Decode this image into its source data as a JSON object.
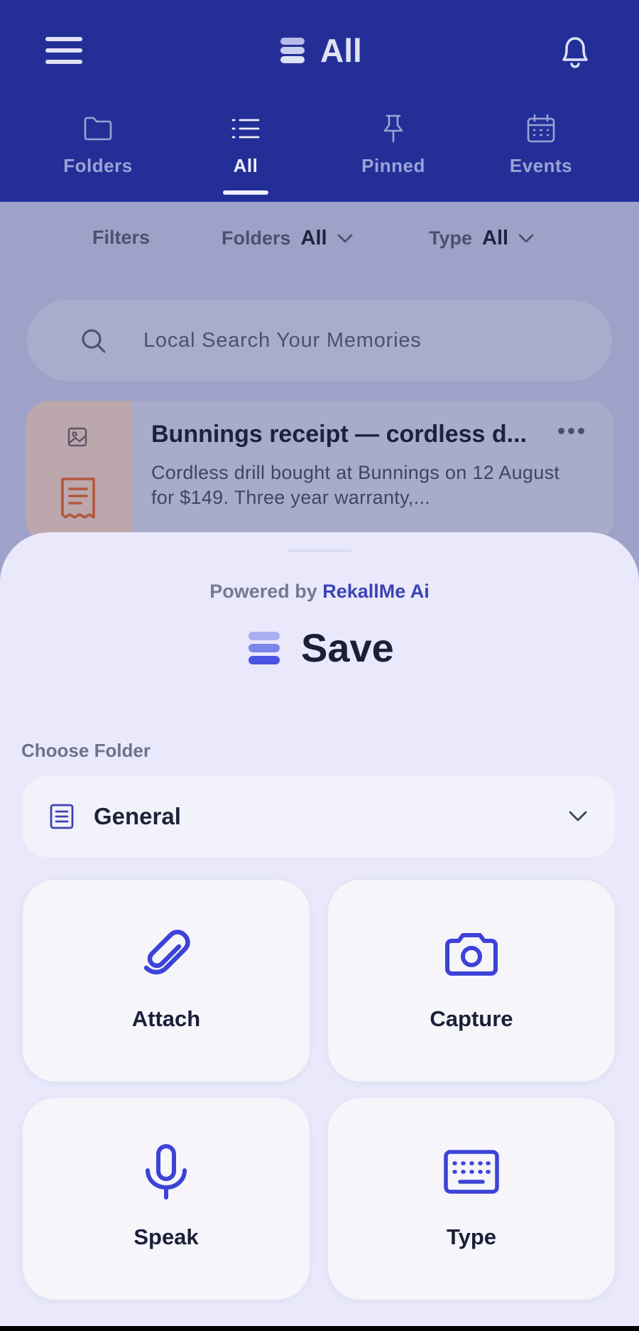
{
  "header": {
    "title": "All",
    "tabs": [
      {
        "label": "Folders",
        "active": false
      },
      {
        "label": "All",
        "active": true
      },
      {
        "label": "Pinned",
        "active": false
      },
      {
        "label": "Events",
        "active": false
      }
    ]
  },
  "filters": {
    "label": "Filters",
    "folders_label": "Folders",
    "folders_value": "All",
    "type_label": "Type",
    "type_value": "All"
  },
  "search": {
    "placeholder": "Local Search Your Memories"
  },
  "card": {
    "title": "Bunnings receipt — cordless d...",
    "description": "Cordless drill bought at Bunnings on 12 August for $149. Three year warranty,..."
  },
  "sheet": {
    "powered_prefix": "Powered by",
    "powered_brand": "RekallMe Ai",
    "title": "Save",
    "choose_folder_label": "Choose Folder",
    "selected_folder": "General",
    "actions": [
      {
        "label": "Attach",
        "icon": "paperclip-icon"
      },
      {
        "label": "Capture",
        "icon": "camera-icon"
      },
      {
        "label": "Speak",
        "icon": "microphone-icon"
      },
      {
        "label": "Type",
        "icon": "keyboard-icon"
      }
    ]
  },
  "colors": {
    "header_bg": "#232f97",
    "accent": "#3d43b5",
    "sheet_bg": "#e9e9fb"
  }
}
